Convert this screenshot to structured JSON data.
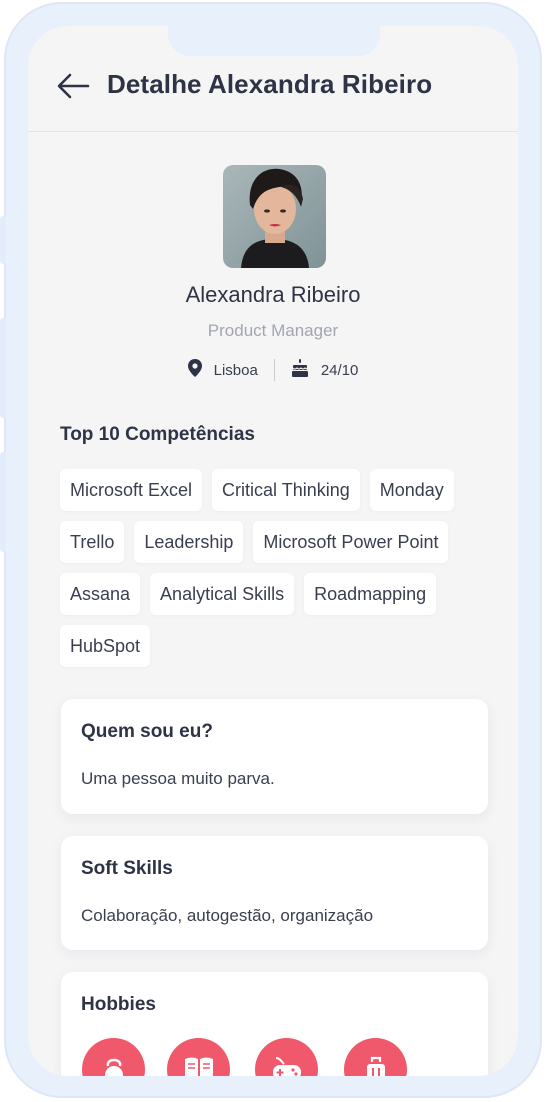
{
  "header": {
    "title": "Detalhe Alexandra Ribeiro"
  },
  "profile": {
    "name": "Alexandra Ribeiro",
    "role": "Product Manager",
    "location": "Lisboa",
    "birthday": "24/10"
  },
  "skills": {
    "title": "Top 10 Competências",
    "items": [
      "Microsoft Excel",
      "Critical Thinking",
      "Monday",
      "Trello",
      "Leadership",
      "Microsoft Power Point",
      "Assana",
      "Analytical Skills",
      "Roadmapping",
      "HubSpot"
    ]
  },
  "about": {
    "title": "Quem sou eu?",
    "text": "Uma pessoa muito parva."
  },
  "soft_skills": {
    "title": "Soft Skills",
    "text": "Colaboração, autogestão, organização"
  },
  "hobbies": {
    "title": "Hobbies",
    "icons": [
      "kettlebell-icon",
      "book-icon",
      "gamepad-icon",
      "suitcase-icon"
    ]
  },
  "colors": {
    "accent": "#f0596b",
    "text": "#2e3446",
    "muted": "#a3a6b2",
    "frame": "#e8f0fc"
  }
}
